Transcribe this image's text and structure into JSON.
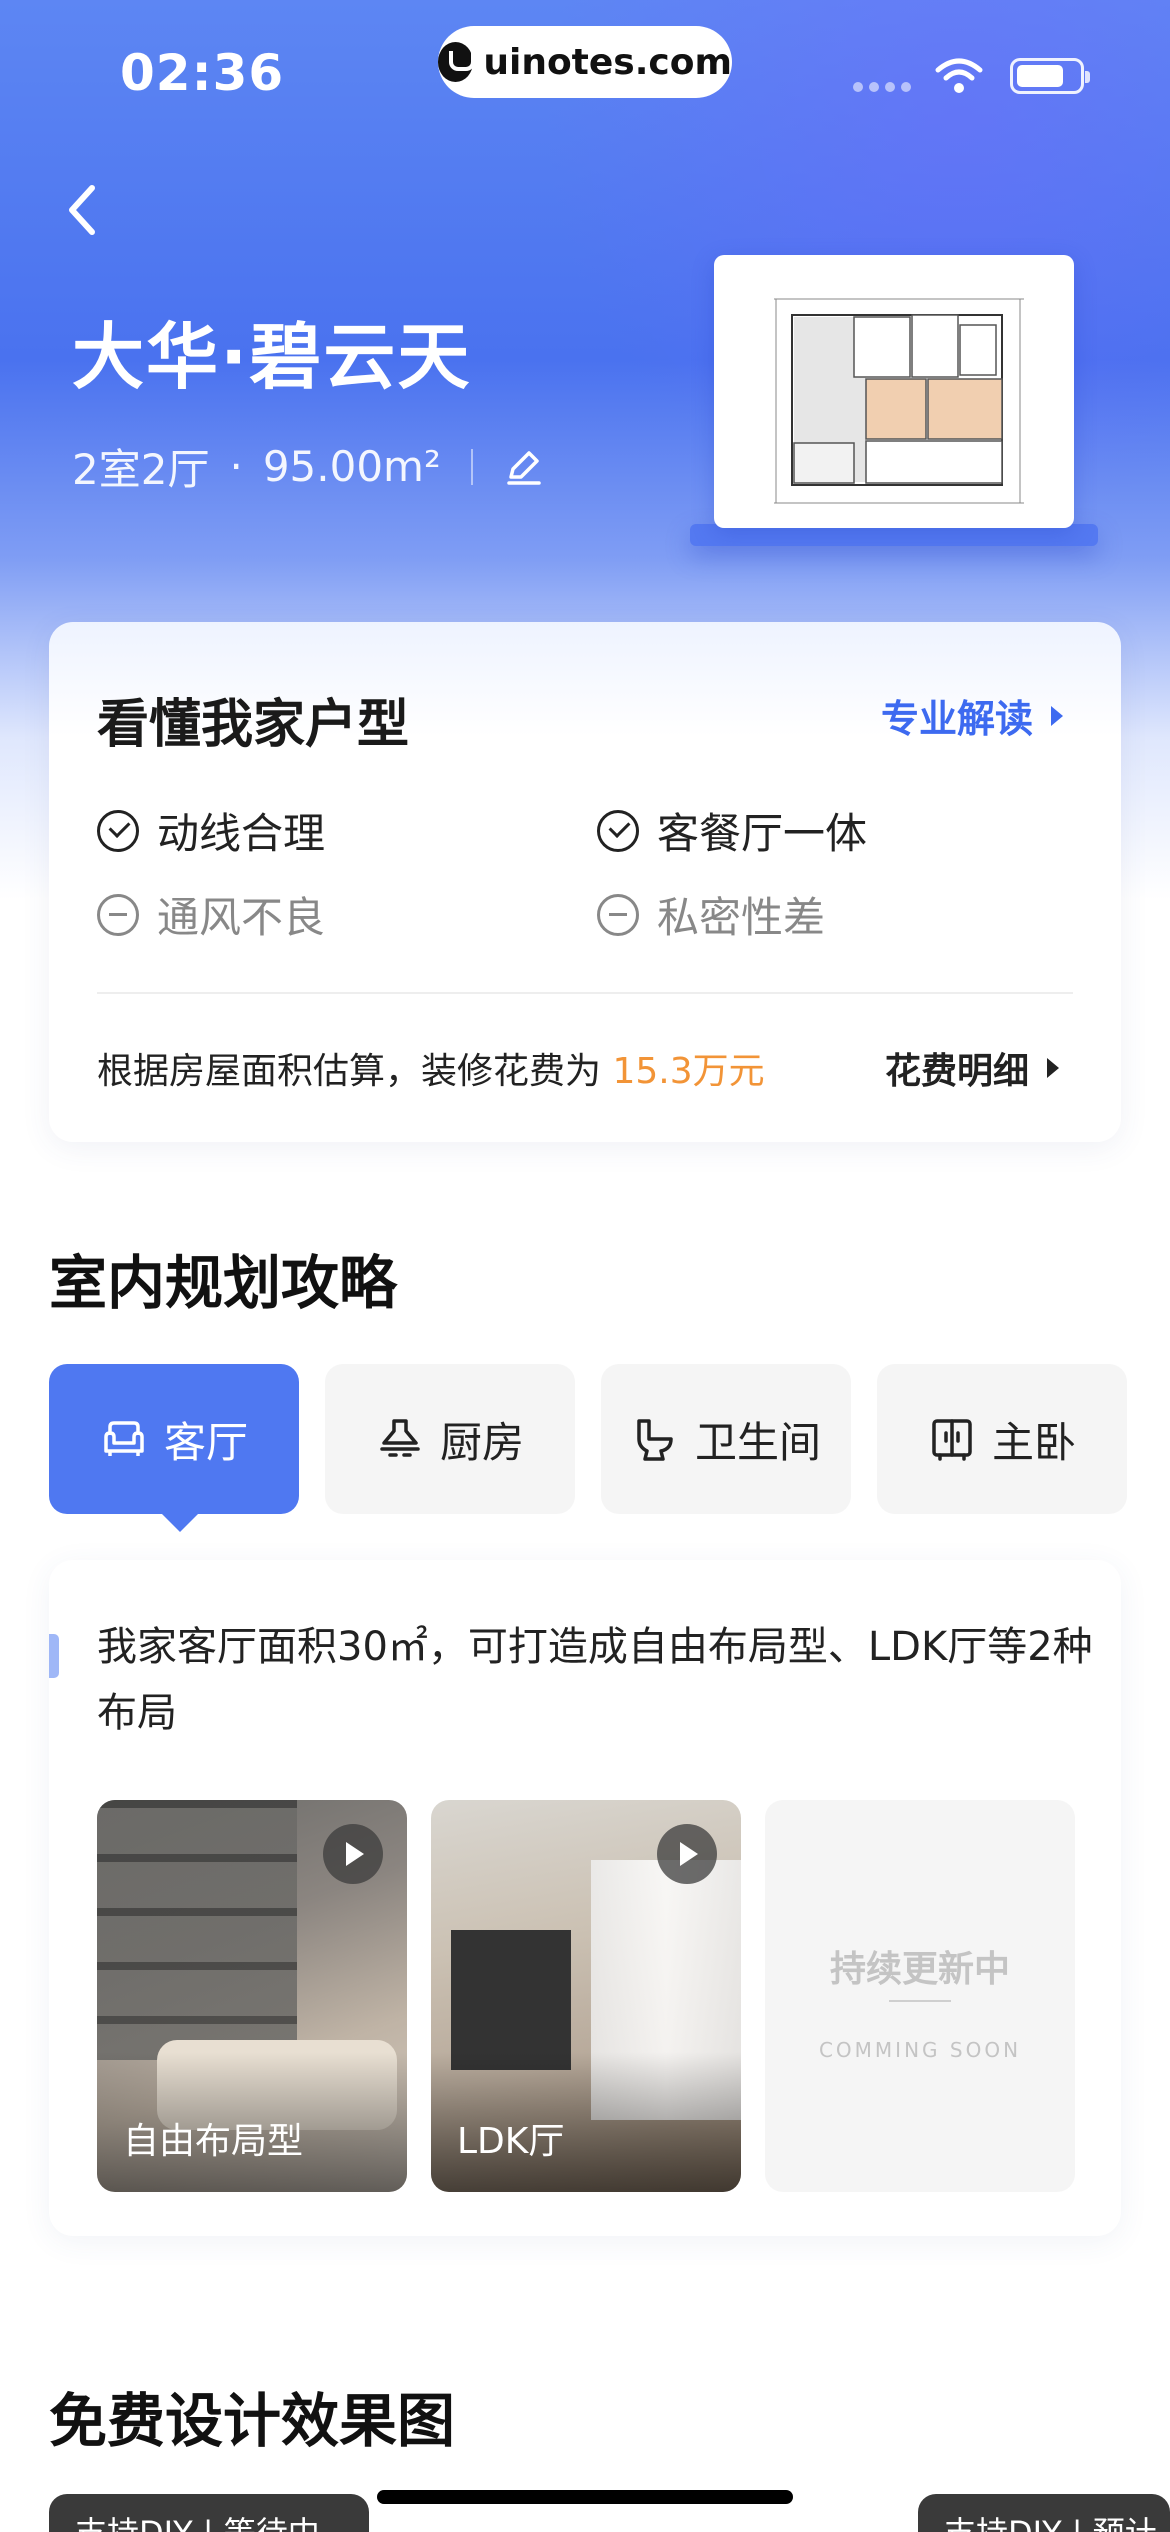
{
  "status_bar": {
    "time": "02:36",
    "url": "uinotes.com"
  },
  "header": {
    "title": "大华·碧云天",
    "rooms": "2室2厅",
    "dot": "·",
    "area": "95.00m²"
  },
  "understand_card": {
    "title": "看懂我家户型",
    "link": "专业解读",
    "features": [
      {
        "label": "动线合理",
        "status": "good"
      },
      {
        "label": "客餐厅一体",
        "status": "good"
      },
      {
        "label": "通风不良",
        "status": "bad"
      },
      {
        "label": "私密性差",
        "status": "bad"
      }
    ],
    "cost_text": "根据房屋面积估算，装修花费为 ",
    "cost_amount": "15.3万元",
    "cost_link": "花费明细"
  },
  "planning": {
    "title": "室内规划攻略",
    "tabs": [
      {
        "label": "客厅",
        "icon": "sofa-icon",
        "active": true
      },
      {
        "label": "厨房",
        "icon": "range-hood-icon",
        "active": false
      },
      {
        "label": "卫生间",
        "icon": "toilet-icon",
        "active": false
      },
      {
        "label": "主卧",
        "icon": "wardrobe-icon",
        "active": false
      }
    ],
    "description": "我家客厅面积30㎡，可打造成自由布局型、LDK厅等2种布局",
    "layouts": [
      {
        "label": "自由布局型"
      },
      {
        "label": "LDK厅"
      }
    ],
    "coming_soon_title": "持续更新中",
    "coming_soon_sub": "COMMING SOON"
  },
  "free_design": {
    "title": "免费设计效果图",
    "chips": [
      "支持DIY | 等待中",
      "支持DIY | 预计"
    ]
  },
  "colors": {
    "accent": "#4f78f1",
    "cost": "#f29437",
    "link": "#3d6af0"
  }
}
